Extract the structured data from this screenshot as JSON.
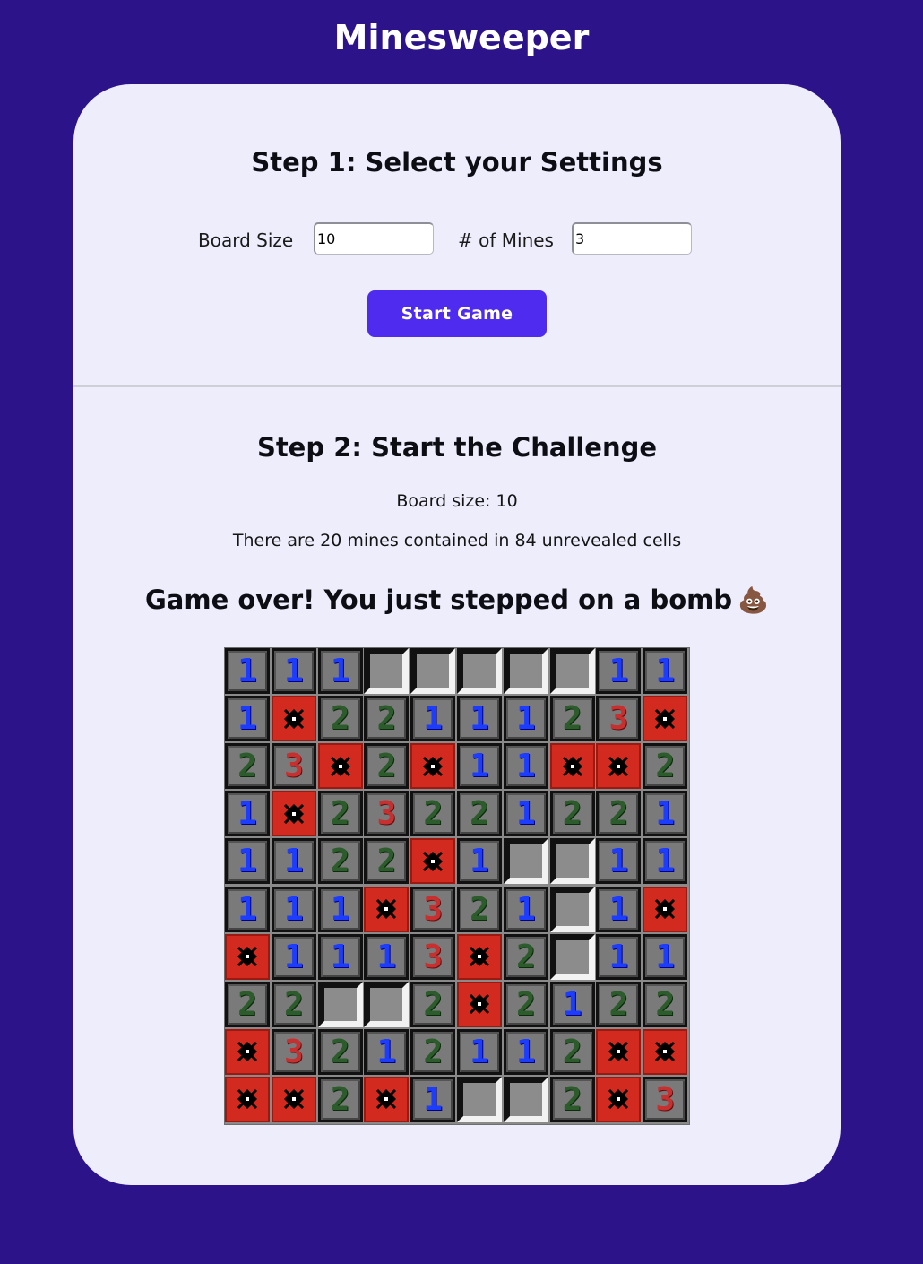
{
  "app": {
    "title": "Minesweeper"
  },
  "step1": {
    "heading": "Step 1: Select your Settings",
    "board_size_label": "Board Size",
    "board_size_value": "10",
    "mines_label": "# of Mines",
    "mines_value": "3",
    "start_button_label": "Start Game"
  },
  "step2": {
    "heading": "Step 2: Start the Challenge",
    "board_size_text": "Board size: 10",
    "mines_info_text": "There are 20 mines contained in 84 unrevealed cells",
    "game_over_text": "Game over! You just stepped on a bomb",
    "game_over_emoji": "💩"
  },
  "board": {
    "size": 10,
    "legend": {
      "M": "mine",
      "H": "hidden",
      "digit": "revealed-number"
    },
    "rows": [
      [
        "1",
        "1",
        "1",
        "H",
        "H",
        "H",
        "H",
        "H",
        "1",
        "1"
      ],
      [
        "1",
        "M",
        "2",
        "2",
        "1",
        "1",
        "1",
        "2",
        "3",
        "M"
      ],
      [
        "2",
        "3",
        "M",
        "2",
        "M",
        "1",
        "1",
        "M",
        "M",
        "2"
      ],
      [
        "1",
        "M",
        "2",
        "3",
        "2",
        "2",
        "1",
        "2",
        "2",
        "1"
      ],
      [
        "1",
        "1",
        "2",
        "2",
        "M",
        "1",
        "H",
        "H",
        "1",
        "1"
      ],
      [
        "1",
        "1",
        "1",
        "M",
        "3",
        "2",
        "1",
        "H",
        "1",
        "M"
      ],
      [
        "M",
        "1",
        "1",
        "1",
        "3",
        "M",
        "2",
        "H",
        "1",
        "1"
      ],
      [
        "2",
        "2",
        "H",
        "H",
        "2",
        "M",
        "2",
        "1",
        "2",
        "2"
      ],
      [
        "M",
        "3",
        "2",
        "1",
        "2",
        "1",
        "1",
        "2",
        "M",
        "M"
      ],
      [
        "M",
        "M",
        "2",
        "M",
        "1",
        "H",
        "H",
        "2",
        "M",
        "3"
      ]
    ]
  },
  "colors": {
    "background": "#2c138a",
    "card": "#ededfb",
    "button": "#4f2bef",
    "number_1": "#1c3cff",
    "number_2": "#2c5c2c",
    "number_3": "#c83030",
    "mine_cell": "#d22a1e"
  }
}
